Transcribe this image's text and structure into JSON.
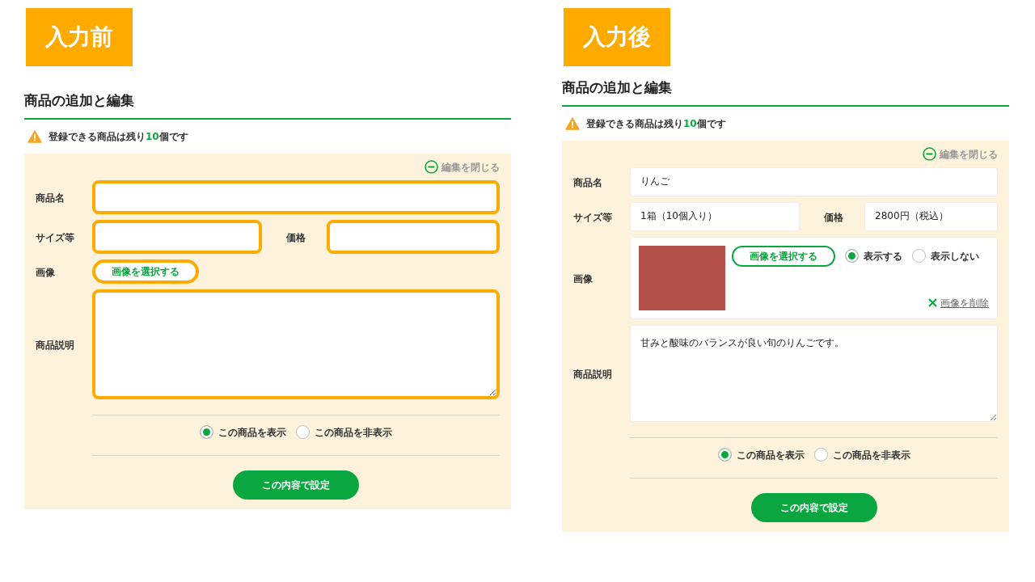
{
  "panels": [
    {
      "badge": "入力前",
      "heading": "商品の追加と編集",
      "notice": {
        "prefix": "登録できる商品は残り",
        "count": "10",
        "suffix": "個です"
      },
      "close_link": "編集を閉じる",
      "fields": {
        "name": {
          "label": "商品名",
          "highlighted": true
        },
        "size": {
          "label": "サイズ等",
          "highlighted": true
        },
        "price": {
          "label": "価格",
          "highlighted": true
        },
        "image": {
          "label": "画像",
          "button": "画像を選択する",
          "highlighted": true,
          "photo": false
        },
        "description": {
          "label": "商品説明",
          "highlighted": true
        }
      },
      "visibility": [
        {
          "label": "この商品を表示",
          "selected": true
        },
        {
          "label": "この商品を非表示",
          "selected": false
        }
      ],
      "submit": "この内容で設定"
    },
    {
      "badge": "入力後",
      "heading": "商品の追加と編集",
      "notice": {
        "prefix": "登録できる商品は残り",
        "count": "10",
        "suffix": "個です"
      },
      "close_link": "編集を閉じる",
      "fields": {
        "name": {
          "label": "商品名",
          "value": "りんご",
          "highlighted": false
        },
        "size": {
          "label": "サイズ等",
          "value": "1箱（10個入り）",
          "highlighted": false
        },
        "price": {
          "label": "価格",
          "value": "2800円（税込）",
          "highlighted": false
        },
        "image": {
          "label": "画像",
          "button": "画像を選択する",
          "highlighted": false,
          "photo": true,
          "display_options": [
            {
              "label": "表示する",
              "selected": true
            },
            {
              "label": "表示しない",
              "selected": false
            }
          ],
          "delete_link": "画像を削除"
        },
        "description": {
          "label": "商品説明",
          "value": "甘みと酸味のバランスが良い旬のりんごです。",
          "highlighted": false
        }
      },
      "visibility": [
        {
          "label": "この商品を表示",
          "selected": true
        },
        {
          "label": "この商品を非表示",
          "selected": false
        }
      ],
      "submit": "この内容で設定"
    }
  ]
}
